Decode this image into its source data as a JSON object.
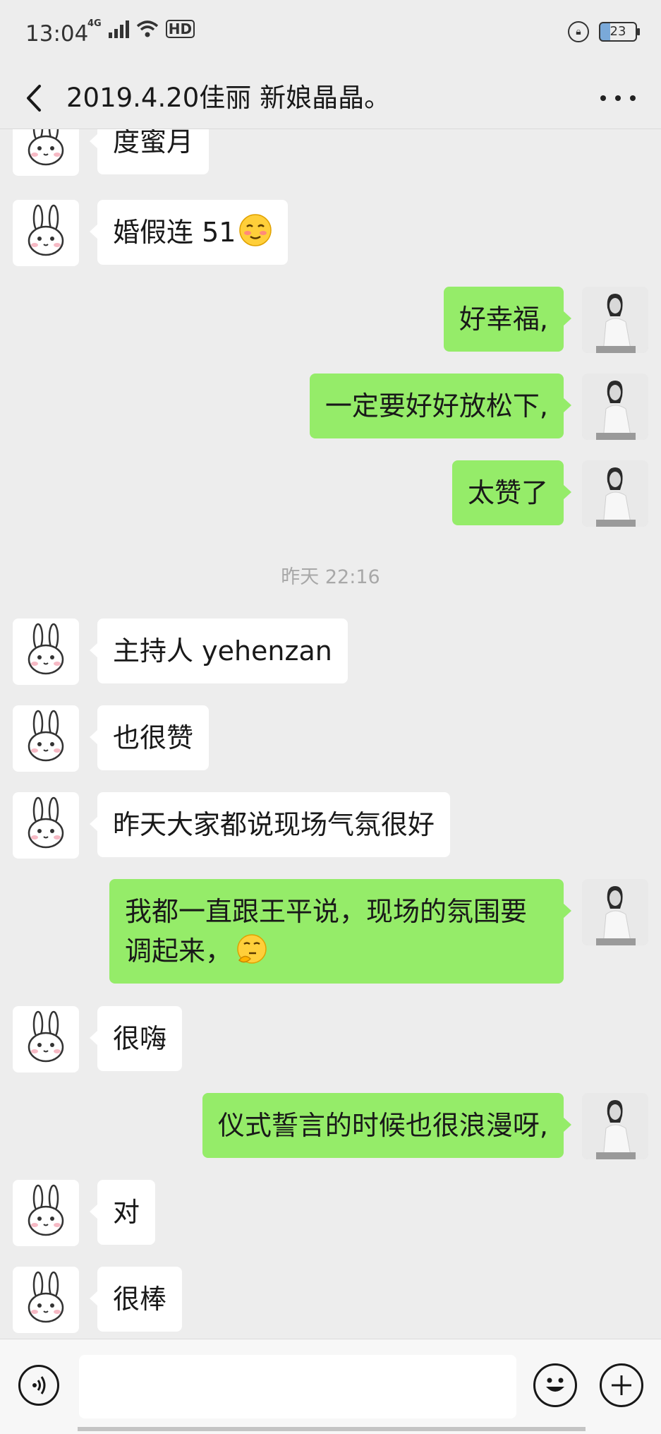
{
  "status_bar": {
    "time": "13:04",
    "network": "4G",
    "hd": "HD",
    "battery": "23"
  },
  "header": {
    "title": "2019.4.20佳丽 新娘晶晶。"
  },
  "messages": [
    {
      "side": "in",
      "text": "度蜜月"
    },
    {
      "side": "in",
      "text": "婚假连 51",
      "emoji": "blush-face-icon"
    },
    {
      "side": "out",
      "text": "好幸福,"
    },
    {
      "side": "out",
      "text": "一定要好好放松下,"
    },
    {
      "side": "out",
      "text": "太赞了"
    },
    {
      "timestamp": "昨天 22:16"
    },
    {
      "side": "in",
      "text": "主持人 yehenzan"
    },
    {
      "side": "in",
      "text": "也很赞"
    },
    {
      "side": "in",
      "text": "昨天大家都说现场气氛很好"
    },
    {
      "side": "out",
      "text": "我都一直跟王平说，现场的氛围要调起来，",
      "emoji": "thinking-face-icon"
    },
    {
      "side": "in",
      "text": "很嗨"
    },
    {
      "side": "out",
      "text": "仪式誓言的时候也很浪漫呀,"
    },
    {
      "side": "in",
      "text": "对"
    },
    {
      "side": "in",
      "text": "很棒"
    }
  ],
  "input_bar": {
    "placeholder": ""
  }
}
